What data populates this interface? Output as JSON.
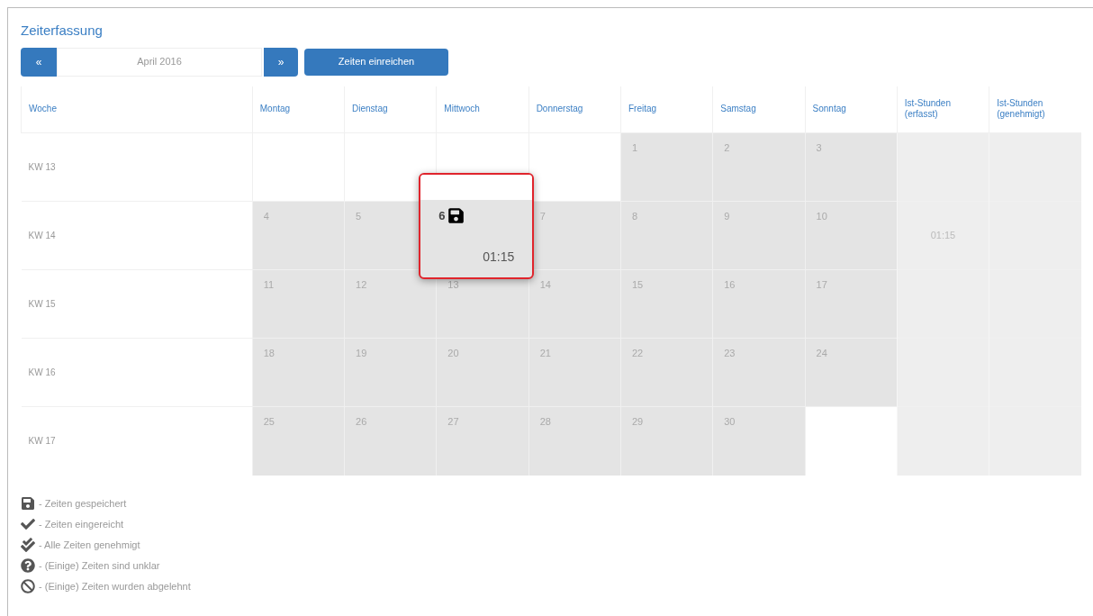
{
  "title": "Zeiterfassung",
  "nav": {
    "prev": "«",
    "month": "April 2016",
    "next": "»",
    "submit": "Zeiten einreichen"
  },
  "columns": [
    "Woche",
    "Montag",
    "Dienstag",
    "Mittwoch",
    "Donnerstag",
    "Freitag",
    "Samstag",
    "Sonntag",
    "Ist-Stunden (erfasst)",
    "Ist-Stunden (genehmigt)"
  ],
  "weeks": [
    {
      "label": "KW 13",
      "days": [
        {
          "in_month": false
        },
        {
          "in_month": false
        },
        {
          "in_month": false
        },
        {
          "in_month": false
        },
        {
          "in_month": true,
          "day": "1"
        },
        {
          "in_month": true,
          "day": "2"
        },
        {
          "in_month": true,
          "day": "3"
        }
      ]
    },
    {
      "label": "KW 14",
      "days": [
        {
          "in_month": true,
          "day": "4"
        },
        {
          "in_month": true,
          "day": "5"
        },
        {
          "in_month": true,
          "day": "6",
          "saved": true,
          "hours": "01:15",
          "highlighted": true
        },
        {
          "in_month": true,
          "day": "7"
        },
        {
          "in_month": true,
          "day": "8"
        },
        {
          "in_month": true,
          "day": "9"
        },
        {
          "in_month": true,
          "day": "10"
        }
      ],
      "recorded": "01:15"
    },
    {
      "label": "KW 15",
      "days": [
        {
          "in_month": true,
          "day": "11"
        },
        {
          "in_month": true,
          "day": "12"
        },
        {
          "in_month": true,
          "day": "13"
        },
        {
          "in_month": true,
          "day": "14"
        },
        {
          "in_month": true,
          "day": "15"
        },
        {
          "in_month": true,
          "day": "16"
        },
        {
          "in_month": true,
          "day": "17"
        }
      ]
    },
    {
      "label": "KW 16",
      "days": [
        {
          "in_month": true,
          "day": "18"
        },
        {
          "in_month": true,
          "day": "19"
        },
        {
          "in_month": true,
          "day": "20"
        },
        {
          "in_month": true,
          "day": "21"
        },
        {
          "in_month": true,
          "day": "22"
        },
        {
          "in_month": true,
          "day": "23"
        },
        {
          "in_month": true,
          "day": "24"
        }
      ]
    },
    {
      "label": "KW 17",
      "days": [
        {
          "in_month": true,
          "day": "25"
        },
        {
          "in_month": true,
          "day": "26"
        },
        {
          "in_month": true,
          "day": "27"
        },
        {
          "in_month": true,
          "day": "28"
        },
        {
          "in_month": true,
          "day": "29"
        },
        {
          "in_month": true,
          "day": "30"
        },
        {
          "in_month": false
        }
      ]
    }
  ],
  "legend": [
    {
      "kind": "saved",
      "text": "- Zeiten gespeichert"
    },
    {
      "kind": "submitted",
      "text": "- Zeiten eingereicht"
    },
    {
      "kind": "approved",
      "text": "- Alle Zeiten genehmigt"
    },
    {
      "kind": "unclear",
      "text": "- (Einige) Zeiten sind unklar"
    },
    {
      "kind": "rejected",
      "text": "- (Einige) Zeiten wurden abgelehnt"
    }
  ]
}
